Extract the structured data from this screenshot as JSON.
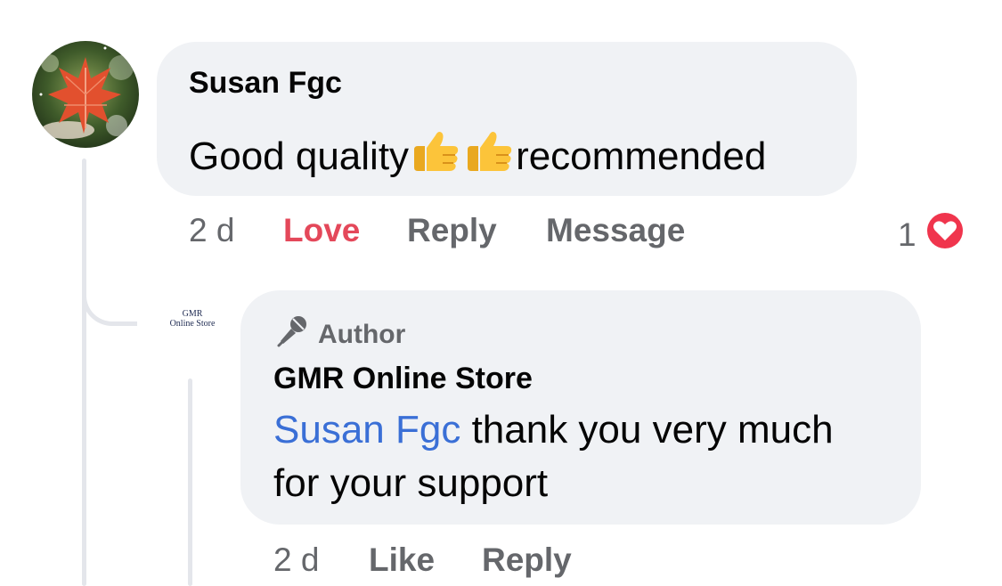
{
  "comment": {
    "author": "Susan Fgc",
    "text_before": "Good quality",
    "emojis": [
      "thumbs-up-emoji",
      "thumbs-up-emoji"
    ],
    "text_after": "recommended",
    "timestamp": "2 d",
    "actions": {
      "love": "Love",
      "reply": "Reply",
      "message": "Message"
    },
    "reaction_count": "1",
    "reaction_icon": "heart-icon",
    "love_color": "#e4485a"
  },
  "reply": {
    "page_logo": {
      "line1": "GMR",
      "line2": "Online Store"
    },
    "badge": "Author",
    "badge_icon": "microphone-icon",
    "author": "GMR Online Store",
    "mention": "Susan Fgc",
    "text_line1": " thank you very much",
    "text_line2": "for your support",
    "timestamp": "2 d",
    "actions": {
      "like": "Like",
      "reply": "Reply"
    },
    "mention_color": "#3a6fd6"
  }
}
